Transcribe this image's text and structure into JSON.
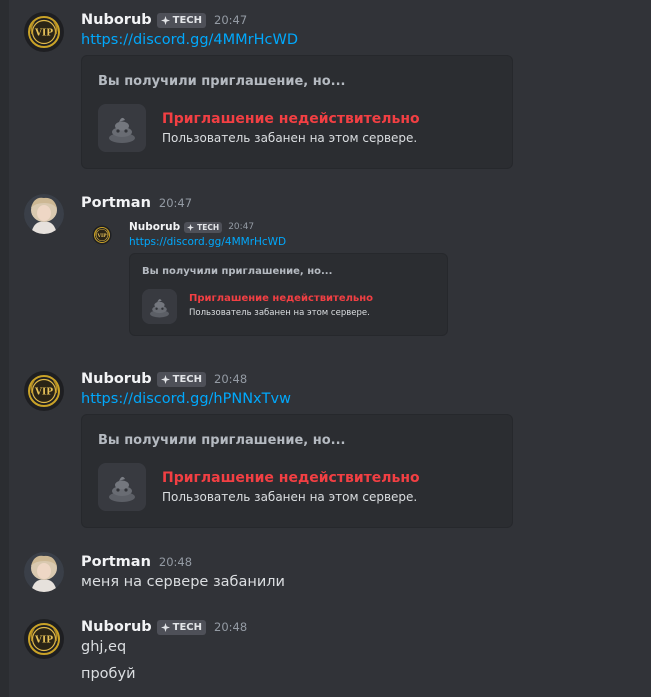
{
  "colors": {
    "background": "#313338",
    "embed_bg": "#2b2d31",
    "link": "#00a8fc",
    "error": "#f23f43",
    "tag_bg": "#4e5058"
  },
  "messages": [
    {
      "author": "Nuborub",
      "tag": "TECH",
      "time": "20:47",
      "avatar_icon": "vip-badge-icon",
      "link": "https://discord.gg/4MMrHcWD",
      "embed": {
        "title": "Вы получили приглашение, но...",
        "invalid_title": "Приглашение недействительно",
        "invalid_sub": "Пользователь забанен на этом сервере.",
        "icon": "poop-icon"
      }
    },
    {
      "author": "Portman",
      "time": "20:47",
      "avatar_icon": "user-photo-icon",
      "forward": {
        "author": "Nuborub",
        "tag": "TECH",
        "time": "20:47",
        "link": "https://discord.gg/4MMrHcWD",
        "embed": {
          "title": "Вы получили приглашение, но...",
          "invalid_title": "Приглашение недействительно",
          "invalid_sub": "Пользователь забанен на этом сервере."
        }
      }
    },
    {
      "author": "Nuborub",
      "tag": "TECH",
      "time": "20:48",
      "avatar_icon": "vip-badge-icon",
      "link": "https://discord.gg/hPNNxTvw",
      "embed": {
        "title": "Вы получили приглашение, но...",
        "invalid_title": "Приглашение недействительно",
        "invalid_sub": "Пользователь забанен на этом сервере."
      }
    },
    {
      "author": "Portman",
      "time": "20:48",
      "avatar_icon": "user-photo-icon",
      "text": "меня на сервере забанили"
    },
    {
      "author": "Nuborub",
      "tag": "TECH",
      "time": "20:48",
      "avatar_icon": "vip-badge-icon",
      "lines": [
        "ghj,eq",
        "пробуй"
      ]
    }
  ]
}
